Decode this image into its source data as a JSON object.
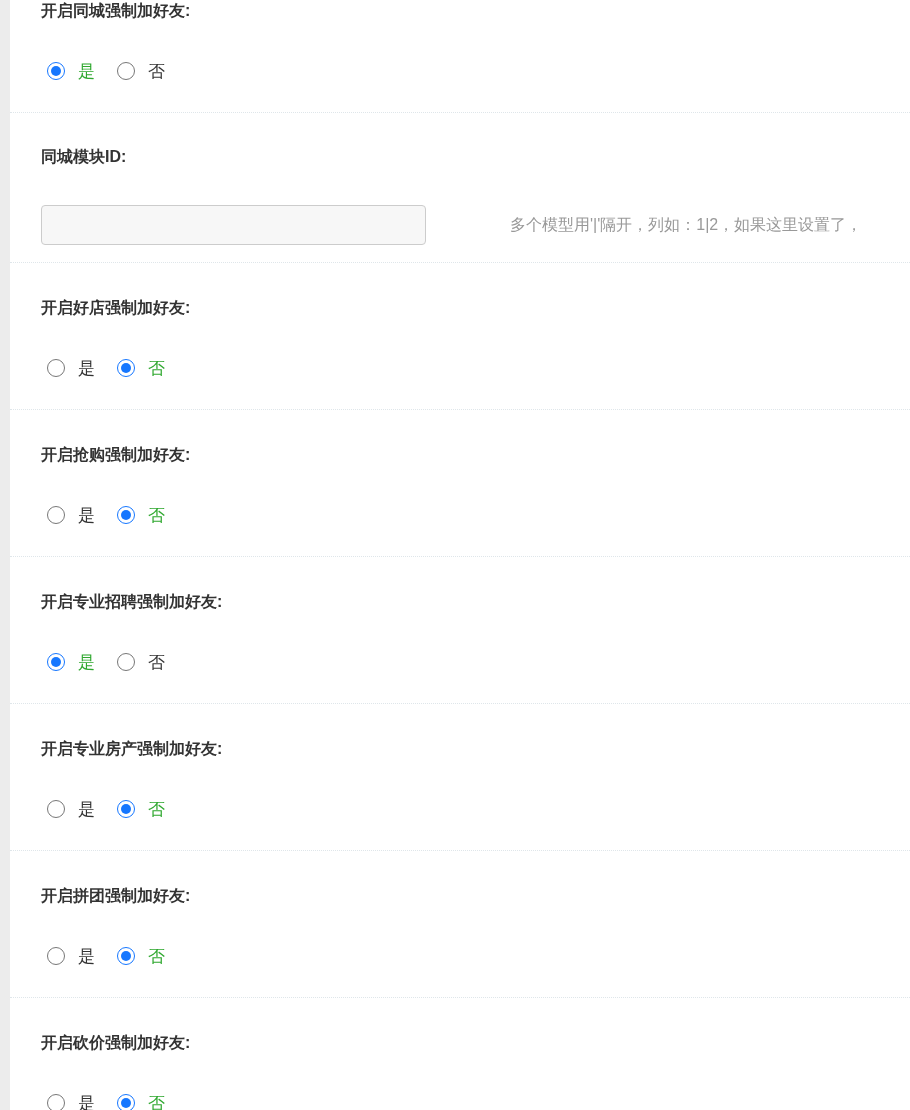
{
  "settings": [
    {
      "kind": "radio",
      "label": "开启同城强制加好友:",
      "options": [
        {
          "label": "是",
          "selected": true
        },
        {
          "label": "否",
          "selected": false
        }
      ]
    },
    {
      "kind": "text",
      "label": "同城模块ID:",
      "hint": "多个模型用'|'隔开，列如：1|2，如果这里设置了，"
    },
    {
      "kind": "radio",
      "label": "开启好店强制加好友:",
      "options": [
        {
          "label": "是",
          "selected": false
        },
        {
          "label": "否",
          "selected": true
        }
      ]
    },
    {
      "kind": "radio",
      "label": "开启抢购强制加好友:",
      "options": [
        {
          "label": "是",
          "selected": false
        },
        {
          "label": "否",
          "selected": true
        }
      ]
    },
    {
      "kind": "radio",
      "label": "开启专业招聘强制加好友:",
      "options": [
        {
          "label": "是",
          "selected": true
        },
        {
          "label": "否",
          "selected": false
        }
      ]
    },
    {
      "kind": "radio",
      "label": "开启专业房产强制加好友:",
      "options": [
        {
          "label": "是",
          "selected": false
        },
        {
          "label": "否",
          "selected": true
        }
      ]
    },
    {
      "kind": "radio",
      "label": "开启拼团强制加好友:",
      "options": [
        {
          "label": "是",
          "selected": false
        },
        {
          "label": "否",
          "selected": true
        }
      ]
    },
    {
      "kind": "radio",
      "label": "开启砍价强制加好友:",
      "options": [
        {
          "label": "是",
          "selected": false
        },
        {
          "label": "否",
          "selected": true
        }
      ]
    }
  ]
}
